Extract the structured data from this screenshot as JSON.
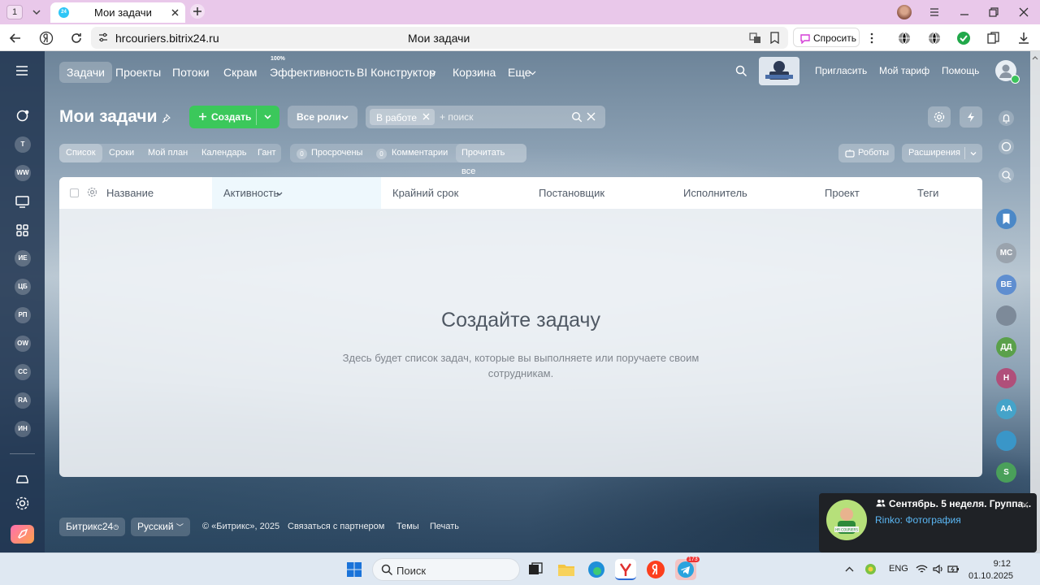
{
  "browser": {
    "tab_count": "1",
    "tab_title": "Мои задачи",
    "url": "hrcouriers.bitrix24.ru",
    "page_title": "Мои задачи",
    "ask_label": "Спросить"
  },
  "topnav": {
    "items": [
      "Задачи",
      "Проекты",
      "Потоки",
      "Скрам",
      "Эффективность",
      "BI Конструктор",
      "Корзина",
      "Еще"
    ],
    "efficiency_badge": "100%",
    "invite": "Пригласить",
    "tariff": "Мой тариф",
    "help": "Помощь"
  },
  "left_sidebar": {
    "avatars": [
      "Т",
      "WW",
      "ИЕ",
      "ЦБ",
      "РП",
      "OW",
      "CC",
      "RA",
      "ИН"
    ]
  },
  "toolbar": {
    "title": "Мои задачи",
    "create": "Создать",
    "roles": "Все роли",
    "filter_chip": "В работе",
    "search_placeholder": "+ поиск"
  },
  "view_tabs": [
    "Список",
    "Сроки",
    "Мой план",
    "Календарь",
    "Гант"
  ],
  "counters": {
    "overdue_count": "0",
    "overdue_label": "Просрочены",
    "comments_count": "0",
    "comments_label": "Комментарии",
    "read_all": "Прочитать все"
  },
  "robots": "Роботы",
  "extensions": "Расширения",
  "grid": {
    "columns": [
      "Название",
      "Активность",
      "Крайний срок",
      "Постановщик",
      "Исполнитель",
      "Проект",
      "Теги"
    ],
    "empty_title": "Создайте задачу",
    "empty_text": "Здесь будет список задач, которые вы выполняете или поручаете своим сотрудникам."
  },
  "footer": {
    "brand": "Битрикс24",
    "lang": "Русский",
    "copyright": "© «Битрикс», 2025",
    "partner": "Связаться с партнером",
    "themes": "Темы",
    "print": "Печать"
  },
  "right_sidebar": {
    "avatars": [
      "МС",
      "ВЕ",
      "ДД",
      "Н",
      "АА",
      "S"
    ]
  },
  "notification": {
    "title": "Сентябрь. 5 неделя. Группа...",
    "text": "Rinko: Фотография",
    "avatar_caption": "HR COURIERS"
  },
  "taskbar": {
    "search": "Поиск",
    "lang": "ENG",
    "time": "9:12",
    "date": "01.10.2025",
    "telegram_badge": "173"
  },
  "colors": {
    "accent_green": "#3bc85b",
    "header_bg": "#223752",
    "tab_bar": "#e9c8ea"
  }
}
